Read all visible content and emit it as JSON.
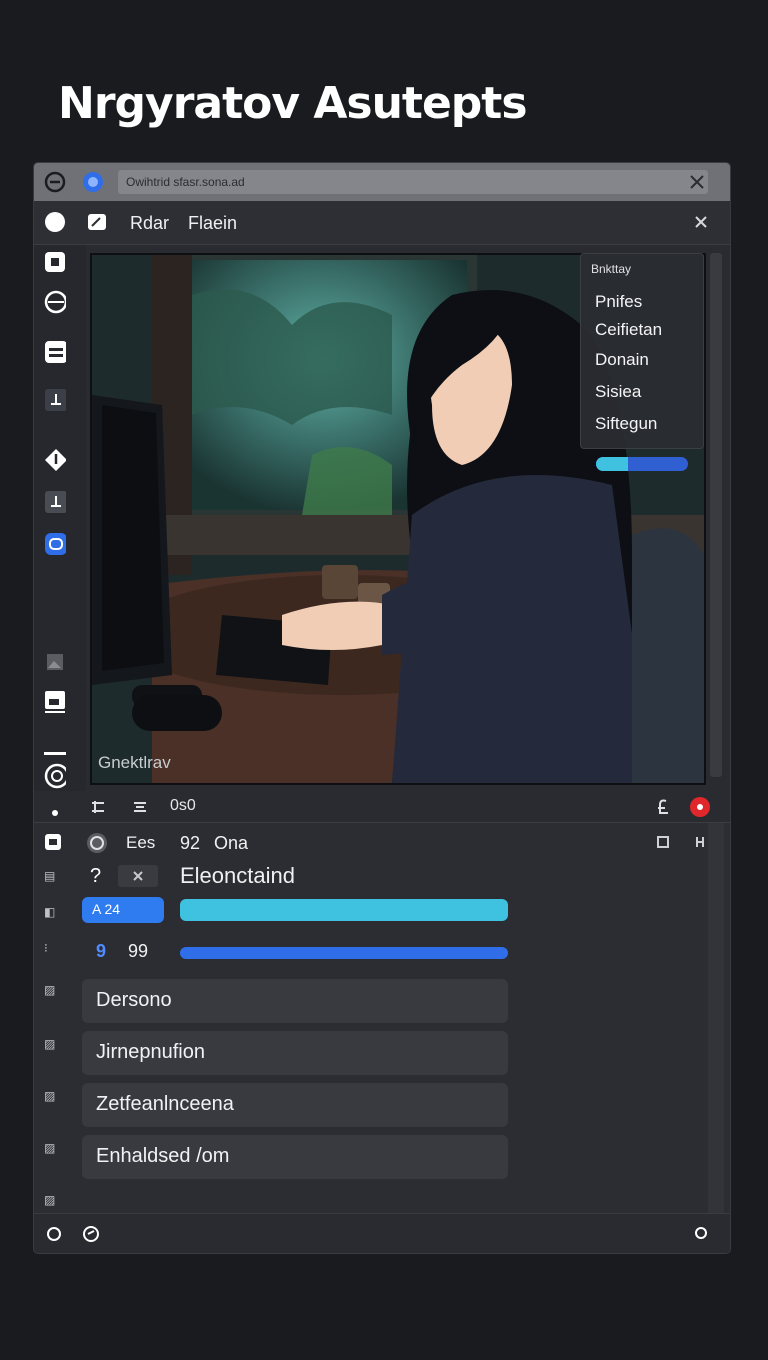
{
  "page": {
    "heading": "Nrgyratov Asutepts"
  },
  "address_bar": {
    "url": "Owihtrid sfasr.sona.ad"
  },
  "toolbar": {
    "tab_one": "Rdar",
    "tab_two": "Flaein"
  },
  "scene": {
    "caption": "Gnektlrav"
  },
  "popup": {
    "header": "Bnkttay",
    "items": [
      "Pnifes",
      "Ceifietan",
      "Donain",
      "Sisiea",
      "Siftegun"
    ],
    "slider_level_percent": 35
  },
  "status": {
    "code": "0s0"
  },
  "panel": {
    "header_text": "Ees",
    "header_value": "92",
    "header_unit": "Ona",
    "row_one_label": "Eleonctaind",
    "chip_label": "A 24",
    "row_three_left": "9",
    "row_three_right": "99",
    "bar_one_level_percent": 100,
    "bar_two_level_percent": 100,
    "bar_one_color": "#3ec2e0",
    "bar_two_color": "#2f6ee8",
    "list": [
      "Dersono",
      "Jirnepnufion",
      "Zetfeanlnceena",
      "Enhaldsed /om"
    ]
  },
  "colors": {
    "accent": "#2f7cf0",
    "alert": "#e0282c",
    "background": "#1a1b1f"
  }
}
